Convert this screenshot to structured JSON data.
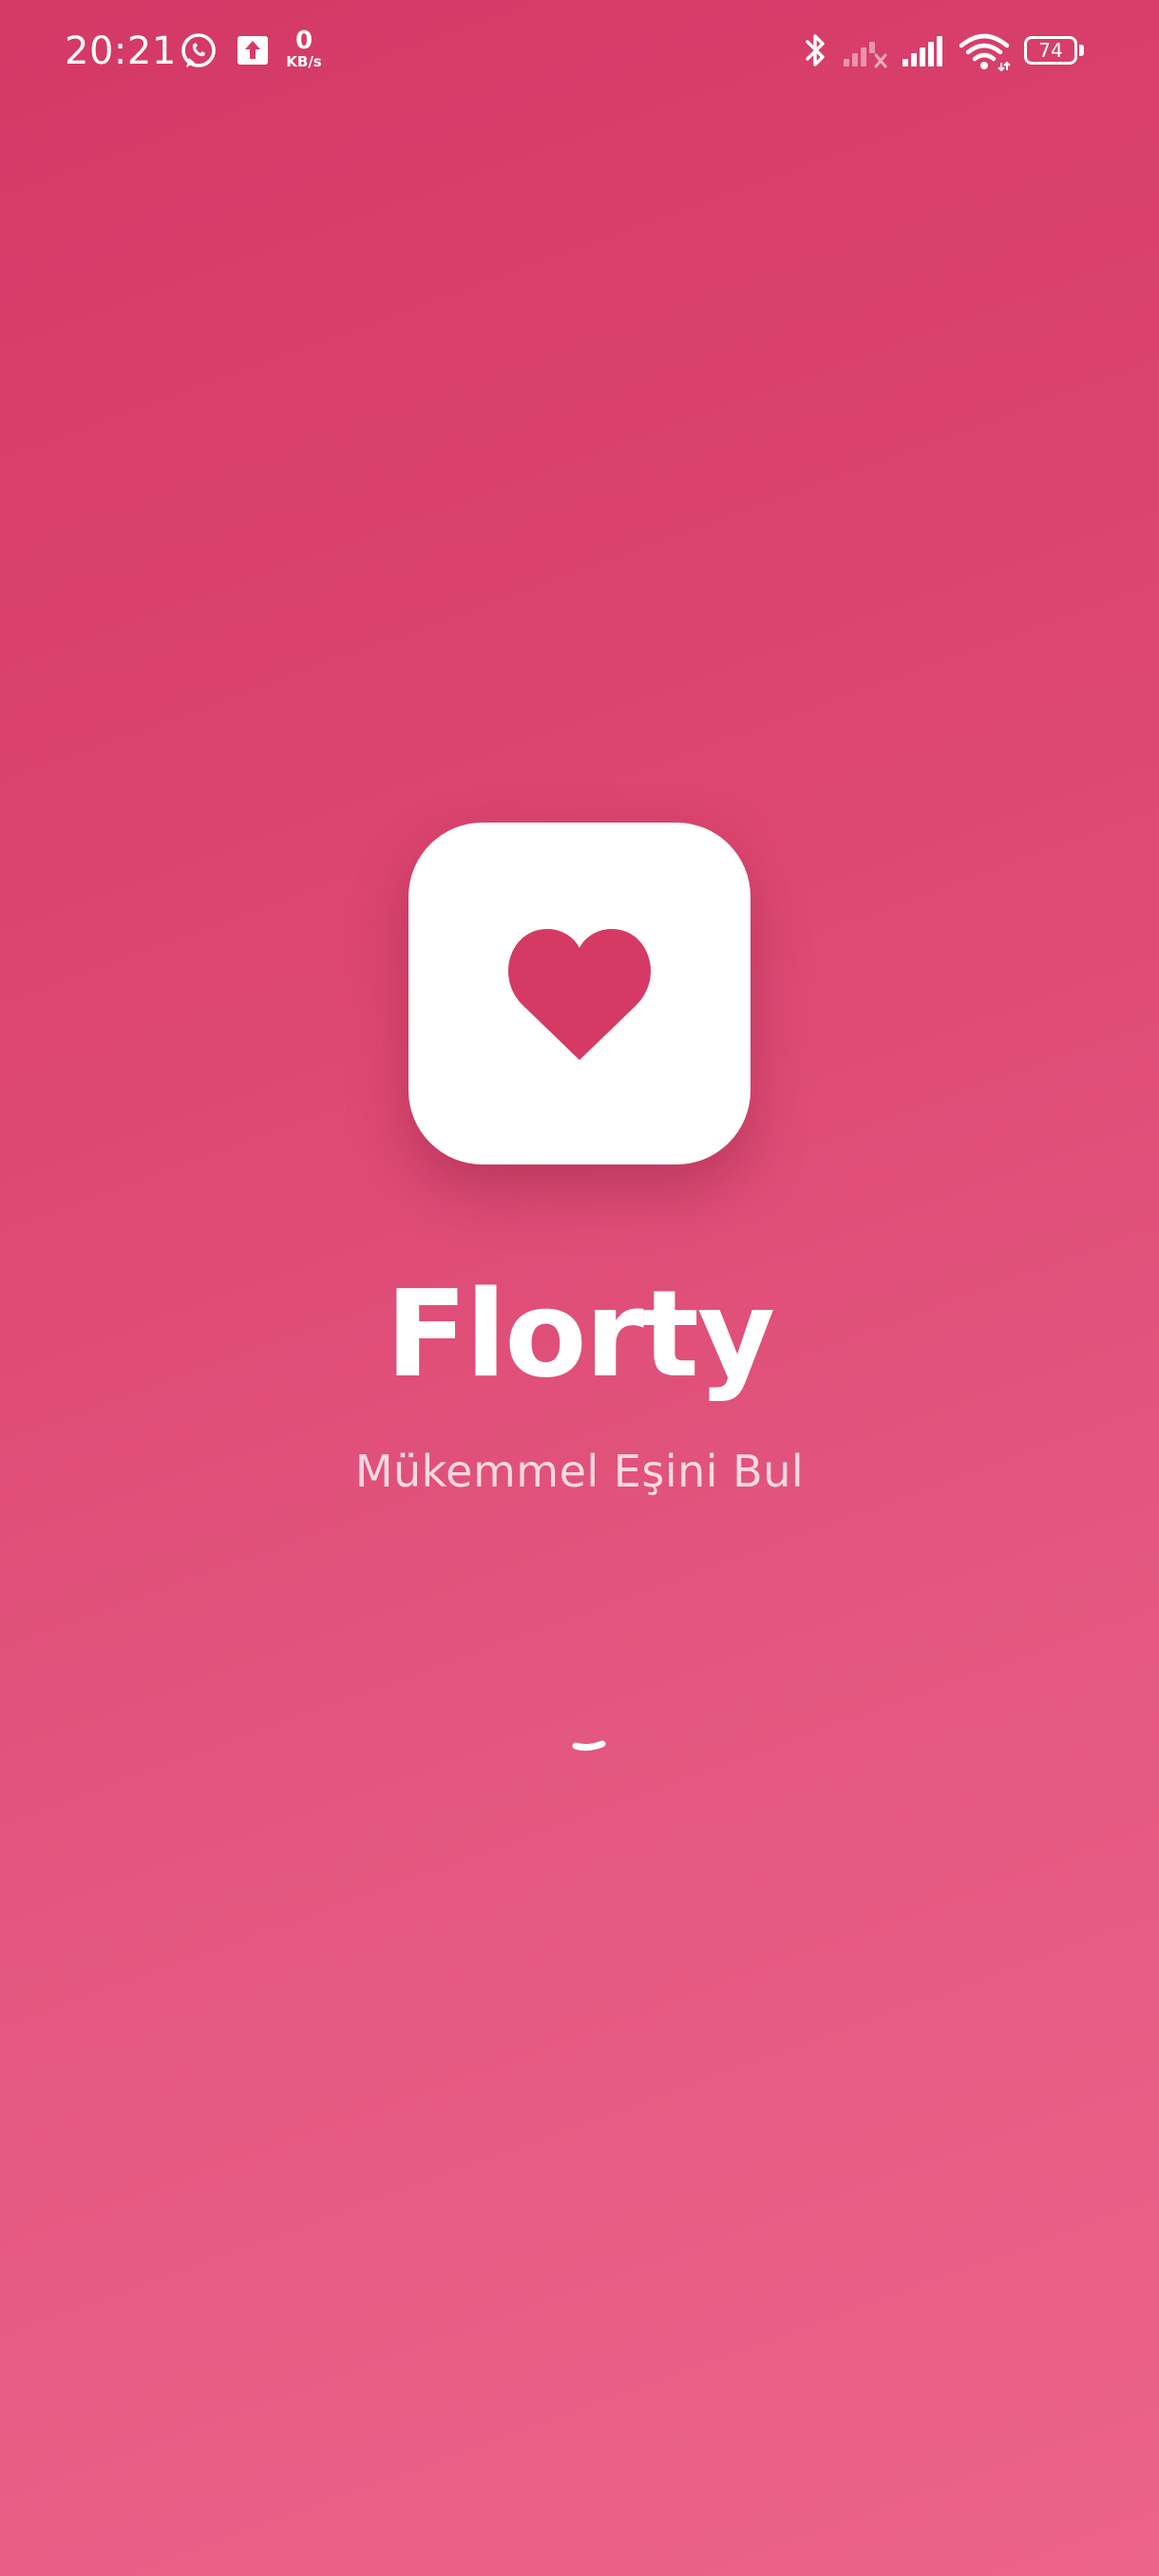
{
  "status_bar": {
    "time": "20:21",
    "net_speed_value": "0",
    "net_speed_unit": "KB/s",
    "battery_level": "74",
    "icons": [
      "whatsapp-icon",
      "upload-icon",
      "bluetooth-icon",
      "signal-no-service-icon",
      "signal-icon",
      "wifi-icon",
      "battery-icon"
    ]
  },
  "splash": {
    "app_name": "Florty",
    "tagline": "Mükemmel Eşini Bul",
    "logo_icon": "heart-icon",
    "loading_indicator": "spinner"
  },
  "colors": {
    "brand": "#d43966",
    "heart": "#d53a65",
    "background_start": "#d43966",
    "background_end": "#ec6389",
    "text": "#ffffff"
  }
}
